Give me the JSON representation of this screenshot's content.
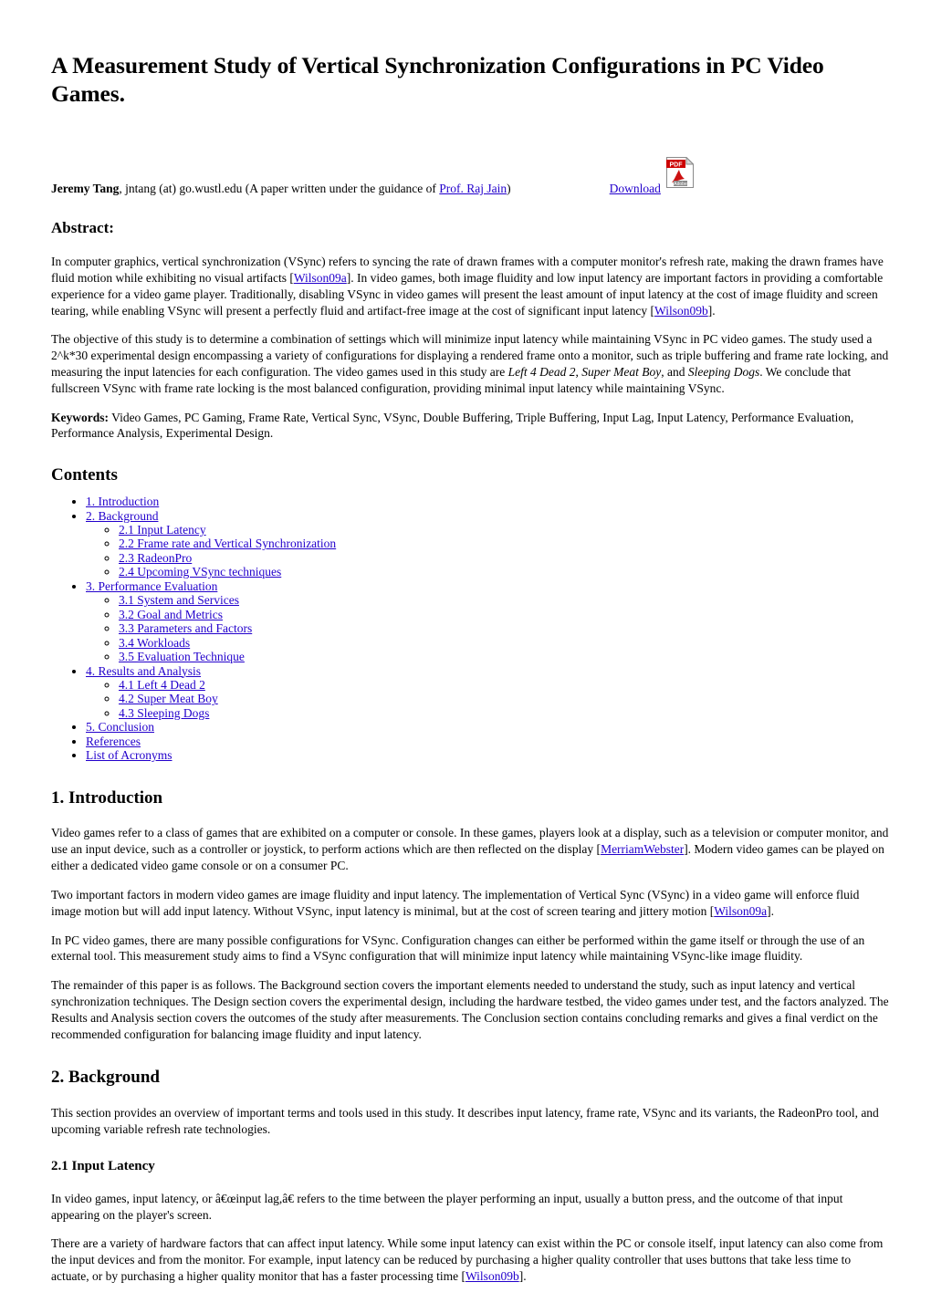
{
  "paper": {
    "title": "A Measurement Study of Vertical Synchronization Configurations in PC Video Games.",
    "author_name": "Jeremy Tang",
    "author_rest": ", jntang (at) go.wustl.edu (A paper written under the guidance of ",
    "advisor_link": "Prof. Raj Jain",
    "author_tail": ")",
    "download_label": "Download",
    "pdf_icon_top_label": "PDF",
    "pdf_icon_bottom_label": "Adobe"
  },
  "abstract": {
    "heading": "Abstract:",
    "p1_a": "In computer graphics, vertical synchronization (VSync) refers to syncing the rate of drawn frames with a computer monitor's refresh rate, making the drawn frames have fluid motion while exhibiting no visual artifacts [",
    "p1_link1": "Wilson09a",
    "p1_b": "]. In video games, both image fluidity and low input latency are important factors in providing a comfortable experience for a video game player. Traditionally, disabling VSync in video games will present the least amount of input latency at the cost of image fluidity and screen tearing, while enabling VSync will present a perfectly fluid and artifact-free image at the cost of significant input latency [",
    "p1_link2": "Wilson09b",
    "p1_c": "].",
    "p2_a": "The objective of this study is to determine a combination of settings which will minimize input latency while maintaining VSync in PC video games. The study used a 2^k*30 experimental design encompassing a variety of configurations for displaying a rendered frame onto a monitor, such as triple buffering and frame rate locking, and measuring the input latencies for each configuration. The video games used in this study are ",
    "p2_game1": "Left 4 Dead 2",
    "p2_sep1": ", ",
    "p2_game2": "Super Meat Boy",
    "p2_sep2": ", and ",
    "p2_game3": "Sleeping Dogs",
    "p2_b": ". We conclude that fullscreen VSync with frame rate locking is the most balanced configuration, providing minimal input latency while maintaining VSync.",
    "keywords_label": "Keywords:",
    "keywords_text": " Video Games, PC Gaming, Frame Rate, Vertical Sync, VSync, Double Buffering, Triple Buffering, Input Lag, Input Latency, Performance Evaluation, Performance Analysis, Experimental Design."
  },
  "contents": {
    "heading": "Contents",
    "items": [
      {
        "label": "1. Introduction",
        "children": []
      },
      {
        "label": "2. Background",
        "children": [
          "2.1 Input Latency",
          "2.2 Frame rate and Vertical Synchronization",
          "2.3 RadeonPro",
          "2.4 Upcoming VSync techniques"
        ]
      },
      {
        "label": "3. Performance Evaluation",
        "children": [
          "3.1 System and Services",
          "3.2 Goal and Metrics",
          "3.3 Parameters and Factors",
          "3.4 Workloads",
          "3.5 Evaluation Technique"
        ]
      },
      {
        "label": "4. Results and Analysis",
        "children": [
          "4.1 Left 4 Dead 2",
          "4.2 Super Meat Boy",
          "4.3 Sleeping Dogs"
        ]
      },
      {
        "label": "5. Conclusion",
        "children": []
      },
      {
        "label": "References",
        "children": []
      },
      {
        "label": "List of Acronyms",
        "children": []
      }
    ]
  },
  "introduction": {
    "heading": "1. Introduction",
    "p1_a": "Video games refer to a class of games that are exhibited on a computer or console. In these games, players look at a display, such as a television or computer monitor, and use an input device, such as a controller or joystick, to perform actions which are then reflected on the display [",
    "p1_link": "MerriamWebster",
    "p1_b": "]. Modern video games can be played on either a dedicated video game console or on a consumer PC.",
    "p2_a": "Two important factors in modern video games are image fluidity and input latency. The implementation of Vertical Sync (VSync) in a video game will enforce fluid image motion but will add input latency. Without VSync, input latency is minimal, but at the cost of screen tearing and jittery motion [",
    "p2_link": "Wilson09a",
    "p2_b": "].",
    "p3": "In PC video games, there are many possible configurations for VSync. Configuration changes can either be performed within the game itself or through the use of an external tool. This measurement study aims to find a VSync configuration that will minimize input latency while maintaining VSync-like image fluidity.",
    "p4": "The remainder of this paper is as follows. The Background section covers the important elements needed to understand the study, such as input latency and vertical synchronization techniques. The Design section covers the experimental design, including the hardware testbed, the video games under test, and the factors analyzed. The Results and Analysis section covers the outcomes of the study after measurements. The Conclusion section contains concluding remarks and gives a final verdict on the recommended configuration for balancing image fluidity and input latency."
  },
  "background": {
    "heading": "2. Background",
    "p1": "This section provides an overview of important terms and tools used in this study. It describes input latency, frame rate, VSync and its variants, the RadeonPro tool, and upcoming variable refresh rate technologies.",
    "sub1_heading": "2.1 Input Latency",
    "sub1_p1": "In video games, input latency, or â€œinput lag,â€ refers to the time between the player performing an input, usually a button press, and the outcome of that input appearing on the player's screen.",
    "sub1_p2_a": "There are a variety of hardware factors that can affect input latency. While some input latency can exist within the PC or console itself, input latency can also come from the input devices and from the monitor. For example, input latency can be reduced by purchasing a higher quality controller that uses buttons that take less time to actuate, or by purchasing a higher quality monitor that has a faster processing time [",
    "sub1_p2_link": "Wilson09b",
    "sub1_p2_b": "]."
  }
}
